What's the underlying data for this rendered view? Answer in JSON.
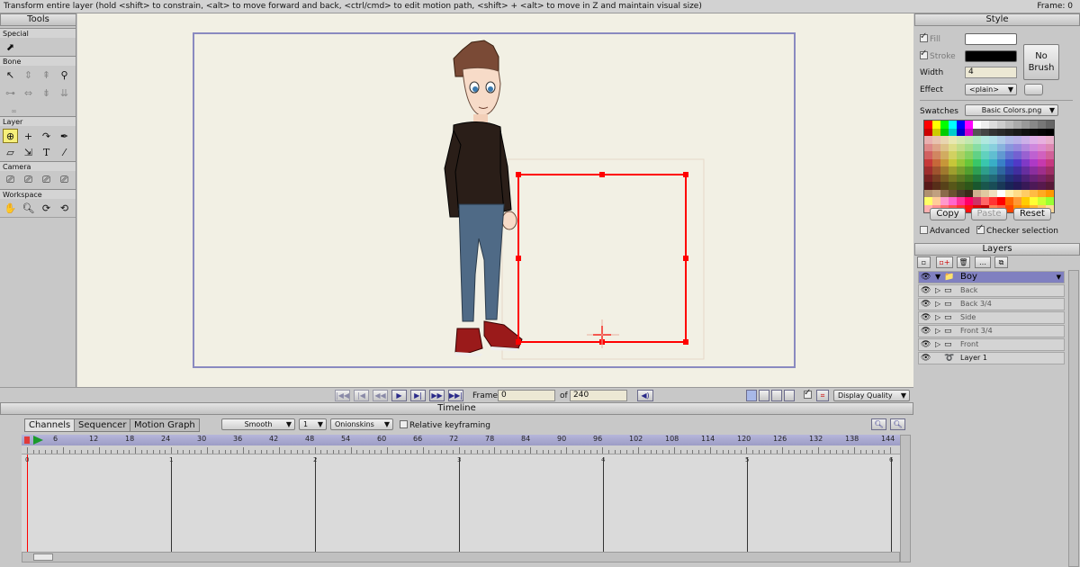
{
  "status": {
    "hint": "Transform entire layer (hold <shift> to constrain, <alt> to move forward and back, <ctrl/cmd> to edit motion path, <shift> + <alt> to move in Z and maintain visual size)",
    "frame": "Frame: 0"
  },
  "tools": {
    "title": "Tools",
    "sections": {
      "special": "Special",
      "bone": "Bone",
      "layer": "Layer",
      "camera": "Camera",
      "workspace": "Workspace"
    },
    "text_tool": "T"
  },
  "playback": {
    "frame_label": "Frame",
    "frame_value": "0",
    "of_label": "of",
    "total_frames": "240",
    "display_quality": "Display Quality"
  },
  "timeline": {
    "title": "Timeline",
    "tabs": [
      "Channels",
      "Sequencer",
      "Motion Graph"
    ],
    "interpolation": "Smooth",
    "onion_count": "1",
    "onionskins": "Onionskins",
    "relative_keyframing": "Relative keyframing",
    "ruler_ticks": [
      "0",
      "6",
      "12",
      "18",
      "24",
      "30",
      "36",
      "42",
      "48",
      "54",
      "60",
      "66",
      "72",
      "78",
      "84",
      "90",
      "96",
      "102",
      "108",
      "114",
      "120",
      "126",
      "132",
      "138",
      "144"
    ],
    "second_marks": [
      "0",
      "1",
      "2",
      "3",
      "4",
      "5",
      "6"
    ]
  },
  "style": {
    "title": "Style",
    "fill_label": "Fill",
    "stroke_label": "Stroke",
    "width_label": "Width",
    "width_value": "4",
    "effect_label": "Effect",
    "effect_value": "<plain>",
    "no_brush": [
      "No",
      "Brush"
    ],
    "swatches_label": "Swatches",
    "swatches_file": "Basic Colors.png",
    "copy": "Copy",
    "paste": "Paste",
    "reset": "Reset",
    "advanced": "Advanced",
    "checker_selection": "Checker selection",
    "fill_color": "#ffffff",
    "stroke_color": "#000000"
  },
  "layers": {
    "title": "Layers",
    "items": [
      {
        "name": "Boy",
        "selected": true,
        "icon": "bone-group-icon"
      },
      {
        "name": "Back",
        "selected": false,
        "icon": "switch-layer-icon"
      },
      {
        "name": "Back 3/4",
        "selected": false,
        "icon": "switch-layer-icon"
      },
      {
        "name": "Side",
        "selected": false,
        "icon": "switch-layer-icon"
      },
      {
        "name": "Front 3/4",
        "selected": false,
        "icon": "switch-layer-icon"
      },
      {
        "name": "Front",
        "selected": false,
        "icon": "switch-layer-icon"
      },
      {
        "name": "Layer 1",
        "selected": false,
        "icon": "vector-layer-icon"
      }
    ]
  },
  "colors": {
    "selection_box": "#ff0000",
    "frame_border": "#8a8ac0",
    "selected_layer": "#8080c0",
    "canvas_bg": "#f2f0e4"
  }
}
